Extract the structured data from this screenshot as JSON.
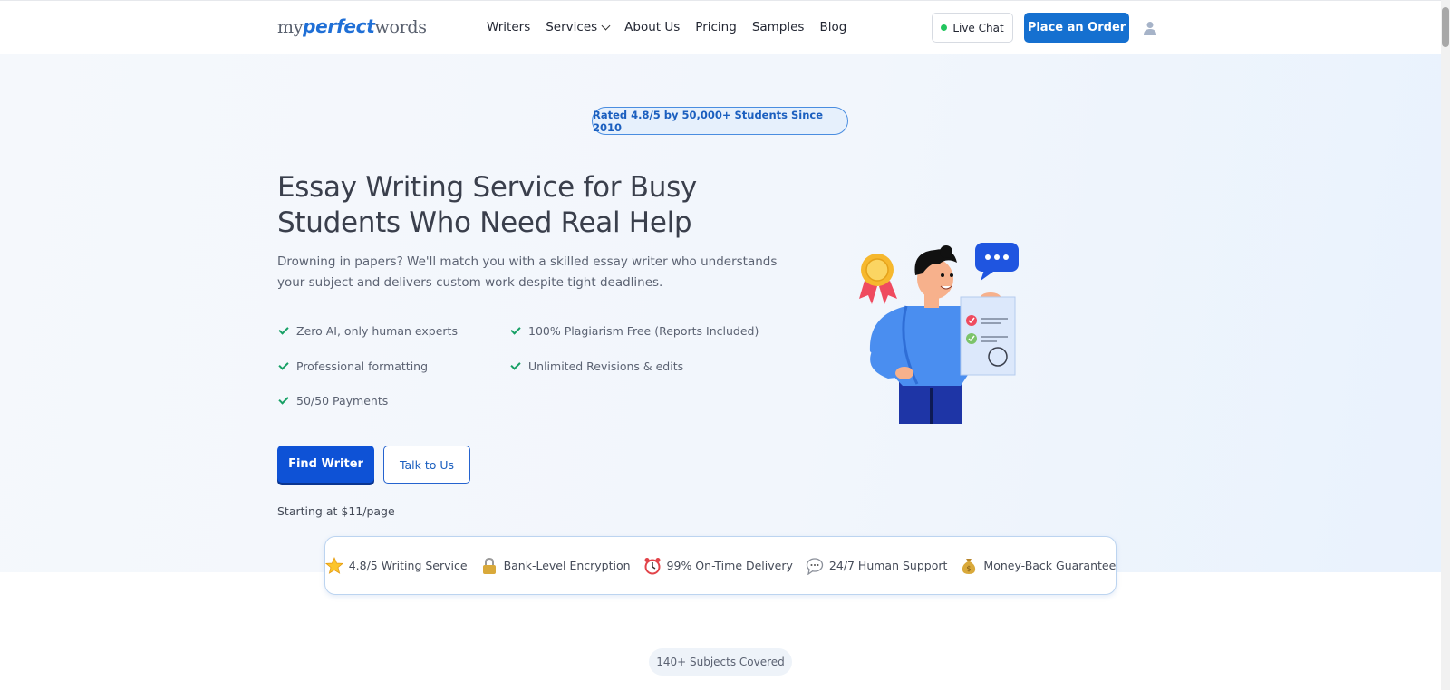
{
  "header": {
    "logo": {
      "pre": "my",
      "mid": "perfect",
      "post": "words"
    },
    "nav": [
      {
        "label": "Writers"
      },
      {
        "label": "Services",
        "has_dropdown": true
      },
      {
        "label": "About Us"
      },
      {
        "label": "Pricing"
      },
      {
        "label": "Samples"
      },
      {
        "label": "Blog"
      }
    ],
    "live_chat_label": "Live Chat",
    "order_label": "Place an Order",
    "user_icon": "user-icon"
  },
  "hero": {
    "rating_pill": "Rated 4.8/5 by 50,000+ Students Since 2010",
    "title": "Essay Writing Service for Busy Students Who Need Real Help",
    "subtitle": "Drowning in papers? We'll match you with a skilled essay writer who understands your subject and delivers custom work despite tight deadlines.",
    "features": [
      "Zero AI, only human experts",
      "100% Plagiarism Free (Reports Included)",
      "Professional formatting",
      "Unlimited Revisions & edits",
      "50/50 Payments"
    ],
    "primary_cta": "Find Writer",
    "secondary_cta": "Talk to Us",
    "starting_price": "Starting at $11/page",
    "illustration": "writer-with-checklist-illustration"
  },
  "trust_bar": [
    {
      "icon": "star-icon",
      "label": "4.8/5 Writing Service"
    },
    {
      "icon": "lock-icon",
      "label": "Bank-Level Encryption"
    },
    {
      "icon": "alarm-clock-icon",
      "label": "99% On-Time Delivery"
    },
    {
      "icon": "speech-bubble-icon",
      "label": "24/7 Human Support"
    },
    {
      "icon": "money-bag-icon",
      "label": "Money-Back Guarantee"
    }
  ],
  "subjects_pill": "140+ Subjects Covered",
  "colors": {
    "brand": "#1570d0",
    "primary_button": "#0e52d6",
    "check": "#17a065",
    "live_dot": "#22c55e"
  }
}
